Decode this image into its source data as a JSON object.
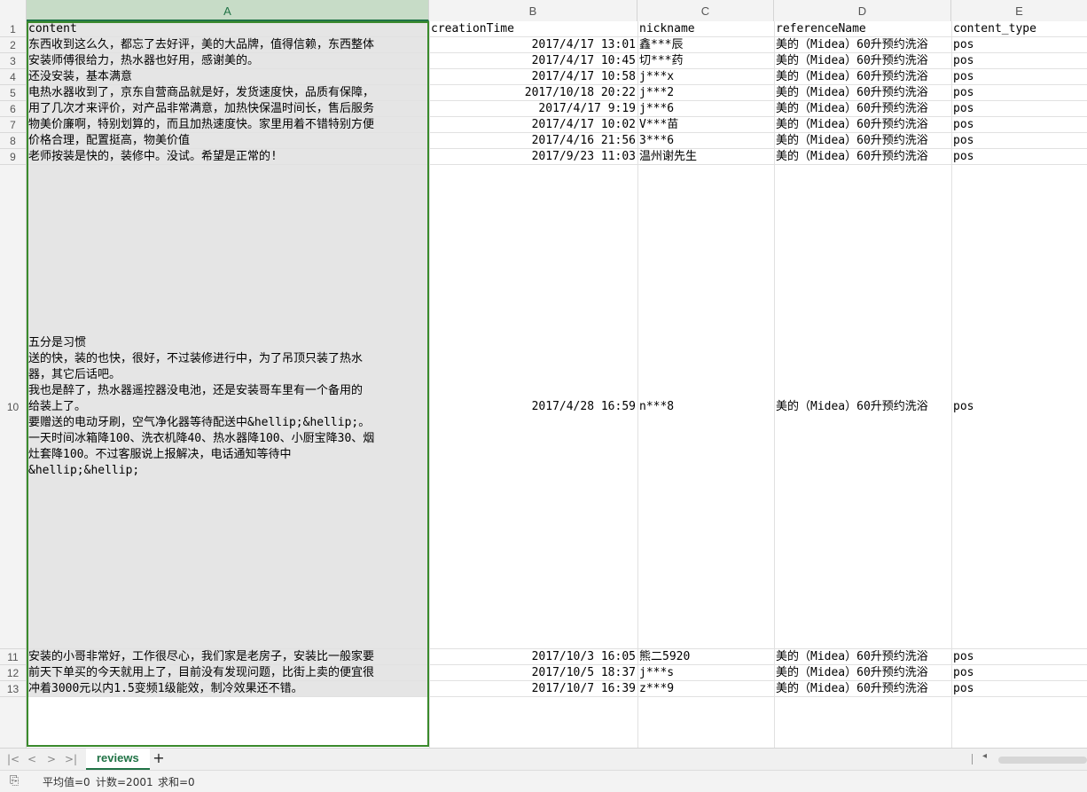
{
  "sheet": {
    "columns": [
      "A",
      "B",
      "C",
      "D",
      "E"
    ],
    "row_numbers": [
      "1",
      "2",
      "3",
      "4",
      "5",
      "6",
      "7",
      "8",
      "9",
      "10",
      "11",
      "12",
      "13"
    ],
    "rows": [
      {
        "content": "content",
        "creationTime": "creationTime",
        "nickname": "nickname",
        "referenceName": "referenceName",
        "content_type": "content_type"
      },
      {
        "content": "东西收到这么久，都忘了去好评，美的大品牌，值得信赖，东西整体",
        "creationTime": "2017/4/17 13:01",
        "nickname": "鑫***辰",
        "referenceName": "美的（Midea）60升预约洗浴",
        "content_type": "pos"
      },
      {
        "content": "安装师傅很给力，热水器也好用，感谢美的。",
        "creationTime": "2017/4/17 10:45",
        "nickname": "切***药",
        "referenceName": "美的（Midea）60升预约洗浴",
        "content_type": "pos"
      },
      {
        "content": "还没安装，基本满意",
        "creationTime": "2017/4/17 10:58",
        "nickname": "j***x",
        "referenceName": "美的（Midea）60升预约洗浴",
        "content_type": "pos"
      },
      {
        "content": "电热水器收到了，京东自营商品就是好，发货速度快，品质有保障，",
        "creationTime": "2017/10/18 20:22",
        "nickname": "j***2",
        "referenceName": "美的（Midea）60升预约洗浴",
        "content_type": "pos"
      },
      {
        "content": "用了几次才来评价，对产品非常满意，加热快保温时间长，售后服务",
        "creationTime": "2017/4/17 9:19",
        "nickname": "j***6",
        "referenceName": "美的（Midea）60升预约洗浴",
        "content_type": "pos"
      },
      {
        "content": "物美价廉啊，特别划算的，而且加热速度快。家里用着不错特别方便",
        "creationTime": "2017/4/17 10:02",
        "nickname": "V***苗",
        "referenceName": "美的（Midea）60升预约洗浴",
        "content_type": "pos"
      },
      {
        "content": "价格合理，配置挺高，物美价值",
        "creationTime": "2017/4/16 21:56",
        "nickname": "3***6",
        "referenceName": "美的（Midea）60升预约洗浴",
        "content_type": "pos"
      },
      {
        "content": "老师按装是快的，装修中。没试。希望是正常的!",
        "creationTime": "2017/9/23 11:03",
        "nickname": "温州谢先生",
        "referenceName": "美的（Midea）60升预约洗浴",
        "content_type": "pos"
      },
      {
        "content": "五分是习惯\n送的快，装的也快，很好，不过装修进行中，为了吊顶只装了热水\n器，其它后话吧。\n我也是醉了，热水器遥控器没电池，还是安装哥车里有一个备用的\n给装上了。\n要赠送的电动牙刷，空气净化器等待配送中&hellip;&hellip;。\n一天时间冰箱降100、洗衣机降40、热水器降100、小厨宝降30、烟\n灶套降100。不过客服说上报解决，电话通知等待中\n&hellip;&hellip;",
        "creationTime": "2017/4/28 16:59",
        "nickname": "n***8",
        "referenceName": "美的（Midea）60升预约洗浴",
        "content_type": "pos"
      },
      {
        "content": "安装的小哥非常好，工作很尽心，我们家是老房子，安装比一般家要",
        "creationTime": "2017/10/3 16:05",
        "nickname": "熊二5920",
        "referenceName": "美的（Midea）60升预约洗浴",
        "content_type": "pos"
      },
      {
        "content": "前天下单买的今天就用上了，目前没有发现问题，比街上卖的便宜很",
        "creationTime": "2017/10/5 18:37",
        "nickname": "j***s",
        "referenceName": "美的（Midea）60升预约洗浴",
        "content_type": "pos"
      },
      {
        "content": "冲着3000元以内1.5变频1级能效，制冷效果还不错。",
        "creationTime": "2017/10/7 16:39",
        "nickname": "z***9",
        "referenceName": "美的（Midea）60升预约洗浴",
        "content_type": "pos"
      }
    ]
  },
  "tabs": {
    "active": "reviews",
    "nav": [
      "|<",
      "<",
      ">",
      ">|"
    ],
    "add": "+"
  },
  "status": {
    "average": "平均值=0",
    "count": "计数=2001",
    "sum": "求和=0"
  },
  "colors": {
    "accent": "#217346",
    "selection_border": "#3a8a2c"
  }
}
